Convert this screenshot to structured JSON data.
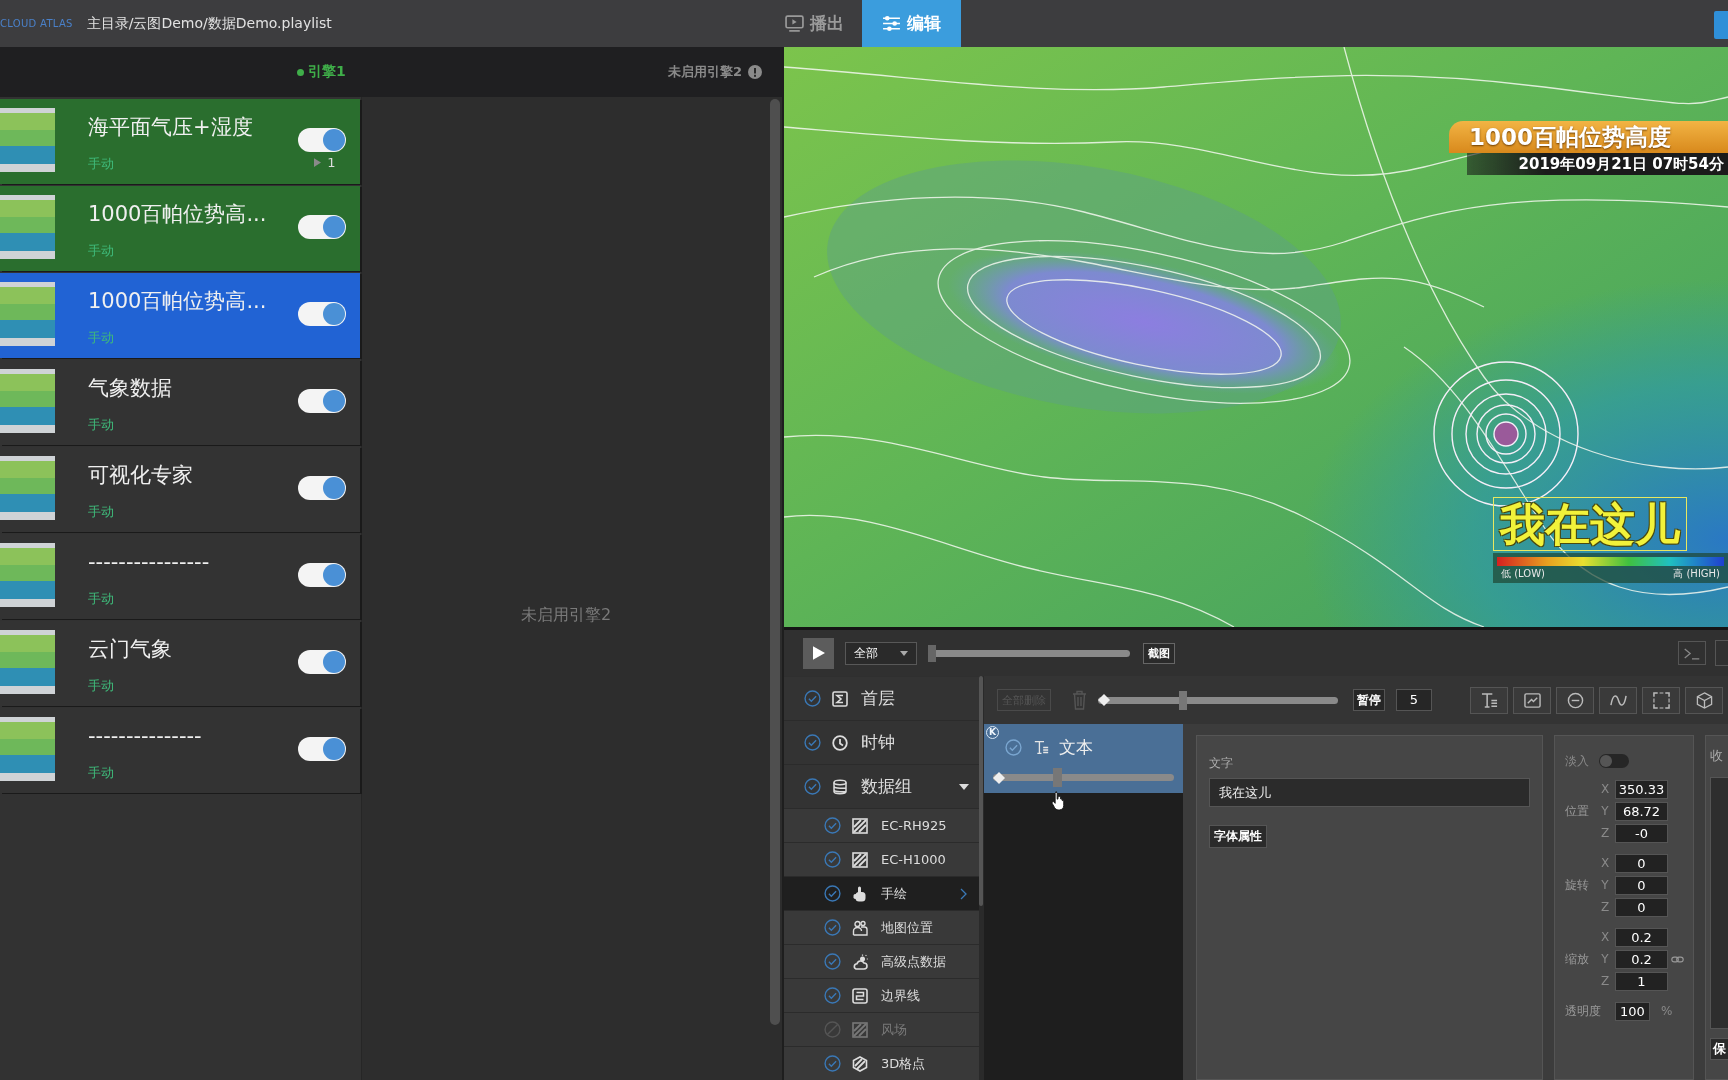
{
  "topbar": {
    "logo": "CLOUD ATLAS",
    "path": "主目录/云图Demo/数据Demo.playlist",
    "tabs": [
      {
        "label": "播出",
        "kind": "playout",
        "selected": false
      },
      {
        "label": "编辑",
        "kind": "edit",
        "selected": true
      }
    ]
  },
  "engines": {
    "engine_1": {
      "label": "引擎1",
      "on": true
    },
    "engine_2": {
      "label": "未启用引擎2"
    },
    "empty_message": "未启用引擎2"
  },
  "playlist": [
    {
      "title": "海平面气压+湿度",
      "mode": "手动",
      "on_air": true,
      "selected": false,
      "enabled": true,
      "play_count": "1"
    },
    {
      "title": "1000百帕位势高...",
      "mode": "手动",
      "on_air": true,
      "selected": false,
      "enabled": true
    },
    {
      "title": "1000百帕位势高...",
      "mode": "手动",
      "on_air": false,
      "selected": true,
      "enabled": true
    },
    {
      "title": "气象数据",
      "mode": "手动",
      "on_air": false,
      "selected": false,
      "enabled": true
    },
    {
      "title": "可视化专家",
      "mode": "手动",
      "on_air": false,
      "selected": false,
      "enabled": true
    },
    {
      "title": "----------------",
      "mode": "手动",
      "on_air": false,
      "selected": false,
      "enabled": true
    },
    {
      "title": "云门气象",
      "mode": "手动",
      "on_air": false,
      "selected": false,
      "enabled": true
    },
    {
      "title": "---------------",
      "mode": "手动",
      "on_air": false,
      "selected": false,
      "enabled": true
    }
  ],
  "preview": {
    "title": "1000百帕位势高度",
    "timestamp": "2019年09月21日 07时54分",
    "caption": "我在这儿",
    "caption_selected": true,
    "legend": {
      "low": "低 (LOW)",
      "high": "高 (HIGH)"
    }
  },
  "controls": {
    "range": "全部",
    "seek": {
      "level": 0
    },
    "snapshot": "截图"
  },
  "layers": [
    {
      "label": "首层",
      "kind": "layer",
      "checked": true,
      "disabled": false,
      "selected": false
    },
    {
      "label": "时钟",
      "kind": "clock",
      "checked": true,
      "disabled": false,
      "selected": false
    },
    {
      "label": "数据组",
      "kind": "group",
      "checked": true,
      "disabled": false,
      "selected": false,
      "expanded": true,
      "children": [
        {
          "label": "EC-RH925",
          "kind": "raster",
          "checked": true,
          "disabled": false,
          "selected": false
        },
        {
          "label": "EC-H1000",
          "kind": "raster",
          "checked": true,
          "disabled": false,
          "selected": false
        },
        {
          "label": "手绘",
          "kind": "drawing",
          "checked": true,
          "disabled": false,
          "selected": true
        },
        {
          "label": "地图位置",
          "kind": "location",
          "checked": true,
          "disabled": false,
          "selected": false
        },
        {
          "label": "高级点数据",
          "kind": "points",
          "checked": true,
          "disabled": false,
          "selected": false
        },
        {
          "label": "边界线",
          "kind": "boundary",
          "checked": true,
          "disabled": false,
          "selected": false
        },
        {
          "label": "风场",
          "kind": "raster",
          "checked": false,
          "disabled": true,
          "selected": false
        },
        {
          "label": "3D格点",
          "kind": "grid3d",
          "checked": true,
          "disabled": false,
          "selected": false
        }
      ]
    }
  ],
  "timeline": {
    "delete_all": {
      "label": "全部删除",
      "disabled": true
    },
    "trash_disabled": true,
    "level": 0.35,
    "pause": "暂停",
    "duration": "5",
    "tools": [
      {
        "kind": "text"
      },
      {
        "kind": "image"
      },
      {
        "kind": "circle"
      },
      {
        "kind": "curve"
      },
      {
        "kind": "rect"
      },
      {
        "kind": "model"
      }
    ]
  },
  "clips": [
    {
      "label": "文本",
      "badge": "K",
      "checked": true,
      "selected": true,
      "level": 0.35
    }
  ],
  "text_props": {
    "label": "文字",
    "value": "我在这儿",
    "font_button": "字体属性"
  },
  "transform": {
    "fade_in": {
      "label": "淡入",
      "on": false
    },
    "groups": [
      {
        "label": "位置",
        "linked": false,
        "fields": [
          {
            "axis": "X",
            "value": "350.33"
          },
          {
            "axis": "Y",
            "value": "68.72"
          },
          {
            "axis": "Z",
            "value": "-0"
          }
        ]
      },
      {
        "label": "旋转",
        "linked": false,
        "fields": [
          {
            "axis": "X",
            "value": "0"
          },
          {
            "axis": "Y",
            "value": "0"
          },
          {
            "axis": "Z",
            "value": "0"
          }
        ]
      },
      {
        "label": "缩放",
        "linked": true,
        "fields": [
          {
            "axis": "X",
            "value": "0.2"
          },
          {
            "axis": "Y",
            "value": "0.2"
          },
          {
            "axis": "Z",
            "value": "1"
          }
        ]
      }
    ],
    "opacity": {
      "label": "透明度",
      "value": "100",
      "unit": "%"
    }
  },
  "side_panel": {
    "title": "收",
    "button": "保"
  }
}
